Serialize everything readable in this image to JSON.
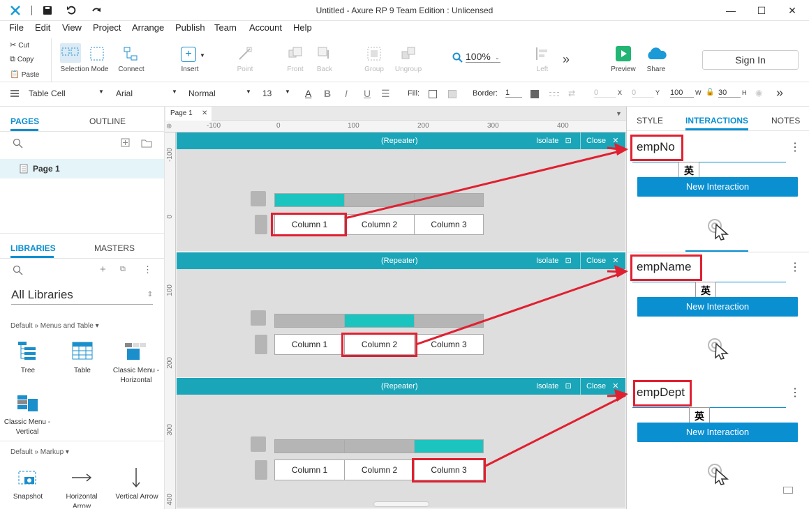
{
  "window": {
    "title": "Untitled - Axure RP 9 Team Edition : Unlicensed"
  },
  "menu": [
    "File",
    "Edit",
    "View",
    "Project",
    "Arrange",
    "Publish",
    "Team",
    "Account",
    "Help"
  ],
  "clipboard": {
    "cut": "Cut",
    "copy": "Copy",
    "paste": "Paste"
  },
  "toolbar": {
    "selection_mode": "Selection Mode",
    "connect": "Connect",
    "insert": "Insert",
    "point": "Point",
    "front": "Front",
    "back": "Back",
    "group": "Group",
    "ungroup": "Ungroup",
    "zoom": "100%",
    "left": "Left",
    "preview": "Preview",
    "share": "Share",
    "sign_in": "Sign In"
  },
  "format": {
    "widget_type": "Table Cell",
    "font": "Arial",
    "weight": "Normal",
    "size": "13",
    "fill_label": "Fill:",
    "border_label": "Border:",
    "border_value": "1",
    "x_value": "0",
    "x_label": "X",
    "y_value": "0",
    "y_label": "Y",
    "w_value": "100",
    "w_label": "W",
    "h_value": "30",
    "h_label": "H"
  },
  "pages_panel": {
    "tab_pages": "PAGES",
    "tab_outline": "OUTLINE",
    "pages": [
      "Page 1"
    ]
  },
  "libraries_panel": {
    "tab_libraries": "LIBRARIES",
    "tab_masters": "MASTERS",
    "selected_library": "All Libraries",
    "group1": "Default » Menus and Table ▾",
    "group1_items": [
      "Tree",
      "Table",
      "Classic Menu - Horizontal",
      "Classic Menu - Vertical"
    ],
    "group2": "Default » Markup ▾",
    "group2_items": [
      "Snapshot",
      "Horizontal Arrow",
      "Vertical Arrow"
    ]
  },
  "canvas": {
    "page_tab": "Page 1",
    "ruler_x": [
      "-100",
      "0",
      "100",
      "200",
      "300",
      "400"
    ],
    "ruler_y_1": [
      "-100",
      "0"
    ],
    "ruler_y_2": [
      "100",
      "200"
    ],
    "ruler_y_3": [
      "300",
      "400"
    ],
    "repeater_title": "(Repeater)",
    "isolate": "Isolate",
    "close": "Close",
    "columns": [
      "Column 1",
      "Column 2",
      "Column 3"
    ]
  },
  "right_panel": {
    "tabs": [
      "STYLE",
      "INTERACTIONS",
      "NOTES"
    ],
    "fields": [
      "empNo",
      "empName",
      "empDept"
    ],
    "new_interaction": "New Interaction",
    "ime": "英"
  },
  "colors": {
    "accent": "#0a8fd1",
    "repeater": "#1aa5b8",
    "active_cell": "#1cc4c0",
    "highlight": "#e02030"
  }
}
